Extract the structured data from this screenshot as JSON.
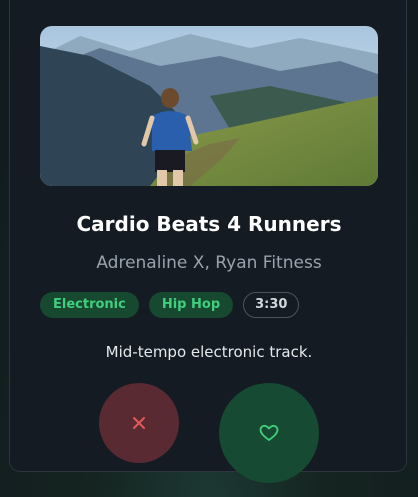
{
  "track": {
    "title": "Cardio Beats 4 Runners",
    "artist": "Adrenaline X, Ryan Fitness",
    "description": "Mid-tempo electronic track.",
    "tags": [
      "Electronic",
      "Hip Hop"
    ],
    "duration": "3:30",
    "cover_image": "runner-on-mountain-trail"
  },
  "actions": {
    "dislike_icon": "x-icon",
    "like_icon": "heart-icon"
  },
  "colors": {
    "card_background": "#141b23",
    "genre_tag_background": "#174830",
    "genre_tag_text": "#3fcf7d",
    "dislike_button": "#5a2a33",
    "dislike_icon": "#e05a5a",
    "like_button": "#174a32",
    "like_icon": "#3fcf7d"
  }
}
